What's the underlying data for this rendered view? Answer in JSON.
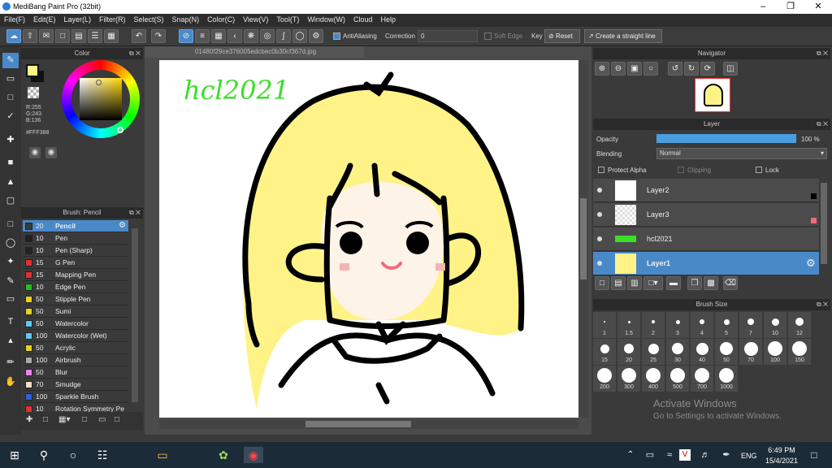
{
  "window": {
    "title": "MediBang Paint Pro (32bit)"
  },
  "menu": [
    "File(F)",
    "Edit(E)",
    "Layer(L)",
    "Filter(R)",
    "Select(S)",
    "Snap(N)",
    "Color(C)",
    "View(V)",
    "Tool(T)",
    "Window(W)",
    "Cloud",
    "Help"
  ],
  "toolbar": {
    "antialias": "AntiAliasing",
    "correction_label": "Correction",
    "correction_value": "0",
    "soft_edge": "Soft Edge",
    "key": "Key",
    "reset": "Reset",
    "straight": "Create a straight line"
  },
  "color": {
    "title": "Color",
    "r": "R:255",
    "g": "G:243",
    "b": "B:136",
    "hex": "#FFF388",
    "fg": "#fff388"
  },
  "brush": {
    "title": "Brush: Pencil",
    "items": [
      {
        "size": "20",
        "name": "Pencil",
        "color": "#3a3a3a"
      },
      {
        "size": "10",
        "name": "Pen",
        "color": "#222"
      },
      {
        "size": "10",
        "name": "Pen (Sharp)",
        "color": "#222"
      },
      {
        "size": "15",
        "name": "G Pen",
        "color": "#e03030"
      },
      {
        "size": "15",
        "name": "Mapping Pen",
        "color": "#e03030"
      },
      {
        "size": "10",
        "name": "Edge Pen",
        "color": "#20c020"
      },
      {
        "size": "50",
        "name": "Stipple Pen",
        "color": "#e8d020"
      },
      {
        "size": "50",
        "name": "Sumi",
        "color": "#e8d020"
      },
      {
        "size": "50",
        "name": "Watercolor",
        "color": "#60c8f0"
      },
      {
        "size": "100",
        "name": "Watercolor (Wet)",
        "color": "#60c8f0"
      },
      {
        "size": "50",
        "name": "Acrylic",
        "color": "#e8d020"
      },
      {
        "size": "100",
        "name": "Airbrush",
        "color": "#aaaaaa"
      },
      {
        "size": "50",
        "name": "Blur",
        "color": "#f080f0"
      },
      {
        "size": "70",
        "name": "Smudge",
        "color": "#f0e0c0"
      },
      {
        "size": "100",
        "name": "Sparkle Brush",
        "color": "#3060e0"
      },
      {
        "size": "10",
        "name": "Rotation Symmetry Pe",
        "color": "#e03030"
      }
    ]
  },
  "document": {
    "filename": "01480f29ce376005edcbec0b30cf367d.jpg",
    "signature": "hcl2021"
  },
  "navigator": {
    "title": "Navigator"
  },
  "layer": {
    "title": "Layer",
    "opacity_label": "Opacity",
    "opacity_value": "100 %",
    "opacity_fraction": 1.0,
    "blending_label": "Blending",
    "blending_value": "Normal",
    "protect_alpha": "Protect Alpha",
    "clipping": "Clipping",
    "lock": "Lock",
    "items": [
      {
        "name": "Layer2"
      },
      {
        "name": "Layer3"
      },
      {
        "name": "hcl2021"
      },
      {
        "name": "Layer1"
      }
    ]
  },
  "brushsize": {
    "title": "Brush Size",
    "labels": [
      "1",
      "1.5",
      "2",
      "3",
      "4",
      "5",
      "7",
      "10",
      "12",
      "15",
      "20",
      "25",
      "30",
      "40",
      "50",
      "70",
      "100",
      "150",
      "200",
      "300",
      "400",
      "500",
      "700",
      "1000"
    ]
  },
  "watermark": {
    "line1": "Activate Windows",
    "line2": "Go to Settings to activate Windows."
  },
  "taskbar": {
    "lang": "ENG",
    "time": "6:49 PM",
    "date": "15/4/2021"
  }
}
